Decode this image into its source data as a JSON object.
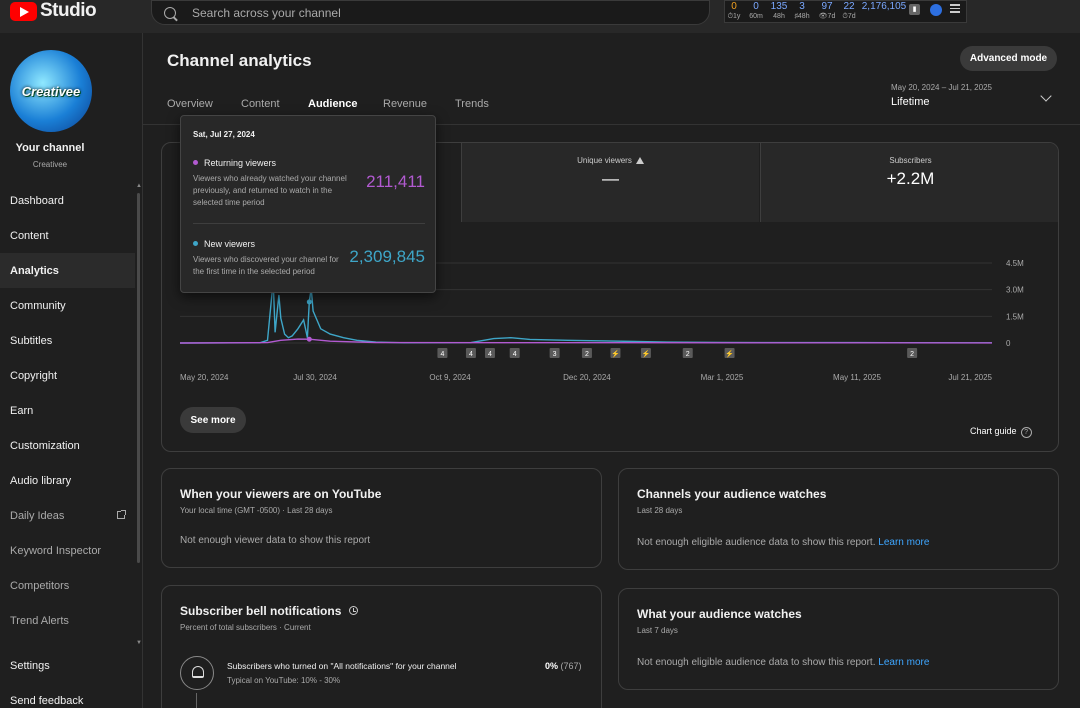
{
  "topbar": {
    "logo_text": "Studio",
    "search_placeholder": "Search across your channel",
    "stats": [
      {
        "value": "0",
        "label": "1y",
        "color": "#f0a020"
      },
      {
        "value": "0",
        "label": "60m",
        "color": "#7aa8ff"
      },
      {
        "value": "135",
        "label": "48h",
        "color": "#7aa8ff"
      },
      {
        "value": "3",
        "label": "48h",
        "color": "#7aa8ff"
      },
      {
        "value": "97",
        "label": "7d",
        "color": "#7aa8ff"
      },
      {
        "value": "22",
        "label": "7d",
        "color": "#7aa8ff"
      },
      {
        "value": "2,176,105",
        "label": "",
        "color": "#7aa8ff"
      }
    ]
  },
  "sidebar": {
    "avatar_text": "Creativee",
    "channel_label": "Your channel",
    "channel_handle": "Creativee",
    "items": [
      {
        "label": "Dashboard"
      },
      {
        "label": "Content"
      },
      {
        "label": "Analytics",
        "active": true
      },
      {
        "label": "Community"
      },
      {
        "label": "Subtitles"
      },
      {
        "label": "Copyright"
      },
      {
        "label": "Earn"
      },
      {
        "label": "Customization"
      },
      {
        "label": "Audio library"
      },
      {
        "label": "Daily Ideas"
      },
      {
        "label": "Keyword Inspector"
      },
      {
        "label": "Competitors"
      },
      {
        "label": "Trend Alerts"
      },
      {
        "label": "Settings"
      },
      {
        "label": "Send feedback"
      }
    ]
  },
  "header": {
    "title": "Channel analytics",
    "advanced_mode": "Advanced mode",
    "tabs": [
      {
        "label": "Overview"
      },
      {
        "label": "Content"
      },
      {
        "label": "Audience",
        "active": true
      },
      {
        "label": "Revenue"
      },
      {
        "label": "Trends"
      }
    ],
    "date_range": "May 20, 2024 – Jul 21, 2025",
    "period": "Lifetime"
  },
  "metrics": [
    {
      "label": "Unique viewers",
      "value": "—"
    },
    {
      "label": "Subscribers",
      "value": "+2.2M"
    }
  ],
  "tooltip": {
    "date": "Sat, Jul 27, 2024",
    "returning_title": "Returning viewers",
    "returning_desc": "Viewers who already watched your channel previously, and returned to watch in the selected time period",
    "returning_value": "211,411",
    "returning_color": "#b25ad1",
    "new_title": "New viewers",
    "new_desc": "Viewers who discovered your channel for the first time in the selected period",
    "new_value": "2,309,845",
    "new_color": "#3ea6c8"
  },
  "chart_data": {
    "type": "line",
    "x_tick_labels": [
      "May 20, 2024",
      "Jul 30, 2024",
      "Oct 9, 2024",
      "Dec 20, 2024",
      "Mar 1, 2025",
      "May 11, 2025",
      "Jul 21, 2025"
    ],
    "y_tick_labels": [
      "4.5M",
      "3.0M",
      "1.5M",
      "0"
    ],
    "ylim": [
      0,
      4500000
    ],
    "series": [
      {
        "name": "New viewers",
        "color": "#3ea6c8",
        "points": [
          [
            "2024-05-20",
            0
          ],
          [
            "2024-07-01",
            10000
          ],
          [
            "2024-07-05",
            150000
          ],
          [
            "2024-07-08",
            3500000
          ],
          [
            "2024-07-09",
            600000
          ],
          [
            "2024-07-11",
            2700000
          ],
          [
            "2024-07-12",
            1400000
          ],
          [
            "2024-07-14",
            500000
          ],
          [
            "2024-07-16",
            300000
          ],
          [
            "2024-07-18",
            400000
          ],
          [
            "2024-07-21",
            800000
          ],
          [
            "2024-07-24",
            1300000
          ],
          [
            "2024-07-26",
            300000
          ],
          [
            "2024-07-27",
            2309845
          ],
          [
            "2024-07-28",
            3100000
          ],
          [
            "2024-07-29",
            1800000
          ],
          [
            "2024-08-02",
            800000
          ],
          [
            "2024-08-07",
            500000
          ],
          [
            "2024-08-14",
            300000
          ],
          [
            "2024-08-21",
            150000
          ],
          [
            "2024-08-31",
            50000
          ],
          [
            "2024-09-15",
            10000
          ],
          [
            "2024-10-20",
            20000
          ],
          [
            "2024-11-01",
            250000
          ],
          [
            "2024-11-10",
            300000
          ],
          [
            "2024-11-20",
            200000
          ],
          [
            "2024-12-10",
            150000
          ],
          [
            "2024-12-30",
            120000
          ],
          [
            "2025-01-31",
            50000
          ],
          [
            "2025-03-01",
            30000
          ],
          [
            "2025-05-11",
            20000
          ],
          [
            "2025-07-21",
            10000
          ]
        ]
      },
      {
        "name": "Returning viewers",
        "color": "#b25ad1",
        "points": [
          [
            "2024-05-20",
            0
          ],
          [
            "2024-07-05",
            20000
          ],
          [
            "2024-07-12",
            150000
          ],
          [
            "2024-07-21",
            220000
          ],
          [
            "2024-07-27",
            211411
          ],
          [
            "2024-08-07",
            100000
          ],
          [
            "2024-08-31",
            20000
          ],
          [
            "2025-07-21",
            5000
          ]
        ]
      }
    ],
    "markers": [
      "4",
      "4",
      "4",
      "4",
      "3",
      "2",
      "short",
      "short",
      "2",
      "short",
      "2"
    ],
    "xlabel": "",
    "ylabel": ""
  },
  "chart_footer": {
    "see_more": "See more",
    "chart_guide": "Chart guide",
    "help_glyph": "?"
  },
  "cards": {
    "when_viewers": {
      "title": "When your viewers are on YouTube",
      "subtitle": "Your local time (GMT -0500) · Last 28 days",
      "body": "Not enough viewer data to show this report"
    },
    "channels_watches": {
      "title": "Channels your audience watches",
      "subtitle": "Last 28 days",
      "body": "Not enough eligible audience data to show this report.",
      "link": "Learn more"
    },
    "bell": {
      "title": "Subscriber bell notifications",
      "subtitle": "Percent of total subscribers · Current",
      "row_label": "Subscribers who turned on \"All notifications\" for your channel",
      "row_sub": "Typical on YouTube: 10% - 30%",
      "row_pct": "0%",
      "row_count": "(767)"
    },
    "what_watches": {
      "title": "What your audience watches",
      "subtitle": "Last 7 days",
      "body": "Not enough eligible audience data to show this report.",
      "link": "Learn more"
    }
  }
}
